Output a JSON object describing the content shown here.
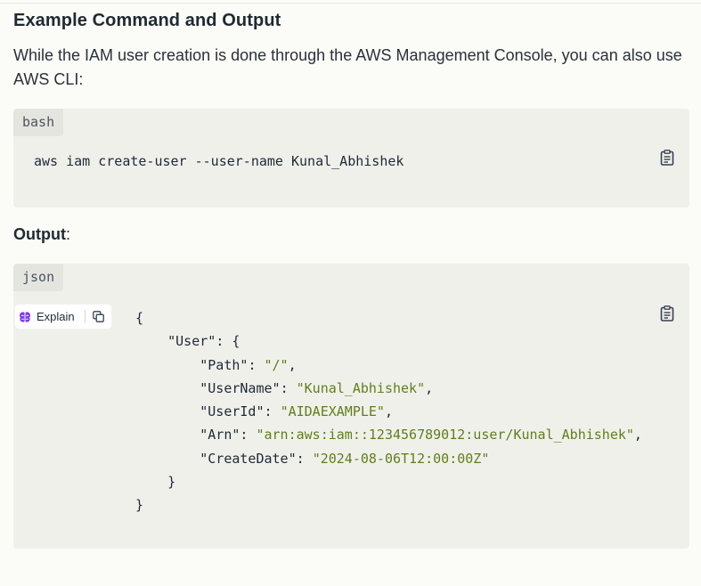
{
  "heading": "Example Command and Output",
  "intro": "While the IAM user creation is done through the AWS Management Console, you can also use AWS CLI:",
  "output_label": "Output",
  "output_colon": ":",
  "bash_block": {
    "lang": "bash",
    "code": "aws iam create-user --user-name Kunal_Abhishek",
    "copy_icon": "clipboard-icon"
  },
  "json_block": {
    "lang": "json",
    "copy_icon": "clipboard-icon",
    "lines": [
      {
        "indent": "",
        "text": "{"
      },
      {
        "indent": "    ",
        "key": "\"User\"",
        "after": ": {"
      },
      {
        "indent": "        ",
        "key": "\"Path\"",
        "sep": ": ",
        "value": "\"/\"",
        "after": ","
      },
      {
        "indent": "        ",
        "key": "\"UserName\"",
        "sep": ": ",
        "value": "\"Kunal_Abhishek\"",
        "after": ","
      },
      {
        "indent": "        ",
        "key": "\"UserId\"",
        "sep": ": ",
        "value": "\"AIDAEXAMPLE\"",
        "after": ","
      },
      {
        "indent": "        ",
        "key": "\"Arn\"",
        "sep": ": ",
        "value": "\"arn:aws:iam::123456789012:user/Kunal_Abhishek\"",
        "after": ","
      },
      {
        "indent": "        ",
        "key": "\"CreateDate\"",
        "sep": ": ",
        "value": "\"2024-08-06T12:00:00Z\"",
        "after": ""
      },
      {
        "indent": "    ",
        "text": "}"
      },
      {
        "indent": "",
        "text": "}"
      }
    ]
  },
  "explain_button": {
    "label": "Explain",
    "icon": "brain-icon",
    "copy_icon": "duplicate-icon",
    "icon_color": "#7c3aed"
  },
  "colors": {
    "string": "#5f7f1a",
    "code_bg": "#f0f0eb",
    "page_bg": "#fbfbf8"
  }
}
